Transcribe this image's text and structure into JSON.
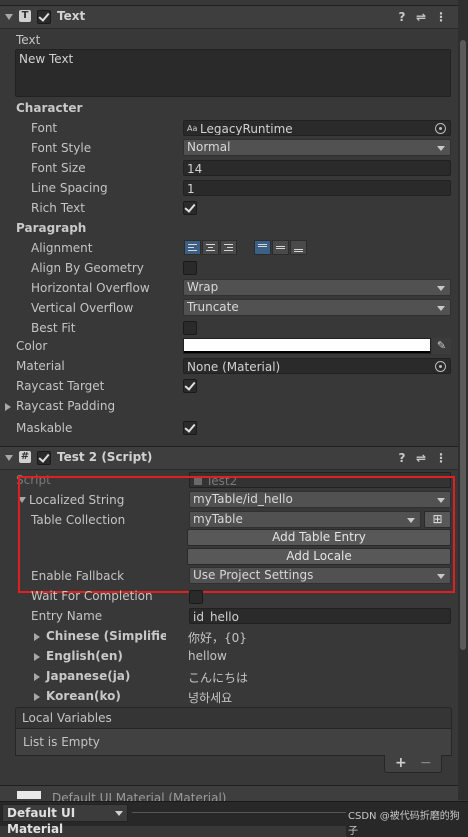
{
  "text_component": {
    "title": "Text",
    "text_label": "Text",
    "text_value": "New Text",
    "character_label": "Character",
    "font_label": "Font",
    "font_value": "LegacyRuntime",
    "font_style_label": "Font Style",
    "font_style_value": "Normal",
    "font_size_label": "Font Size",
    "font_size_value": "14",
    "line_spacing_label": "Line Spacing",
    "line_spacing_value": "1",
    "rich_text_label": "Rich Text",
    "paragraph_label": "Paragraph",
    "alignment_label": "Alignment",
    "align_by_geometry_label": "Align By Geometry",
    "horizontal_overflow_label": "Horizontal Overflow",
    "horizontal_overflow_value": "Wrap",
    "vertical_overflow_label": "Vertical Overflow",
    "vertical_overflow_value": "Truncate",
    "best_fit_label": "Best Fit",
    "color_label": "Color",
    "material_label": "Material",
    "material_value": "None (Material)",
    "raycast_target_label": "Raycast Target",
    "raycast_padding_label": "Raycast Padding",
    "maskable_label": "Maskable"
  },
  "script_component": {
    "title": "Test 2 (Script)",
    "script_label": "Script",
    "script_value": "Test2",
    "localized_string_label": "Localized String",
    "localized_string_value": "myTable/id_hello",
    "table_collection_label": "Table Collection",
    "table_collection_value": "myTable",
    "add_table_entry_label": "Add Table Entry",
    "add_locale_label": "Add Locale",
    "enable_fallback_label": "Enable Fallback",
    "enable_fallback_value": "Use Project Settings",
    "wait_for_completion_label": "Wait For Completion",
    "entry_name_label": "Entry Name",
    "entry_name_value": "id_hello",
    "locales": [
      {
        "name": "Chinese (Simplified)(",
        "value": "你好，{0}"
      },
      {
        "name": "English(en)",
        "value": "hellow"
      },
      {
        "name": "Japanese(ja)",
        "value": "こんにちは"
      },
      {
        "name": "Korean(ko)",
        "value": "녕하세요"
      }
    ],
    "local_variables_label": "Local Variables",
    "list_empty_label": "List is Empty",
    "add_label": "+",
    "remove_label": "−"
  },
  "footer": {
    "material_preview_label": "Default UI Material (Material)",
    "material_dropdown_label": "Default UI Material",
    "watermark": "CSDN @被代码折磨的狗子"
  },
  "colors": {
    "highlight_box": "#e0201e",
    "background": "#383838",
    "field": "#2a2a2a"
  }
}
